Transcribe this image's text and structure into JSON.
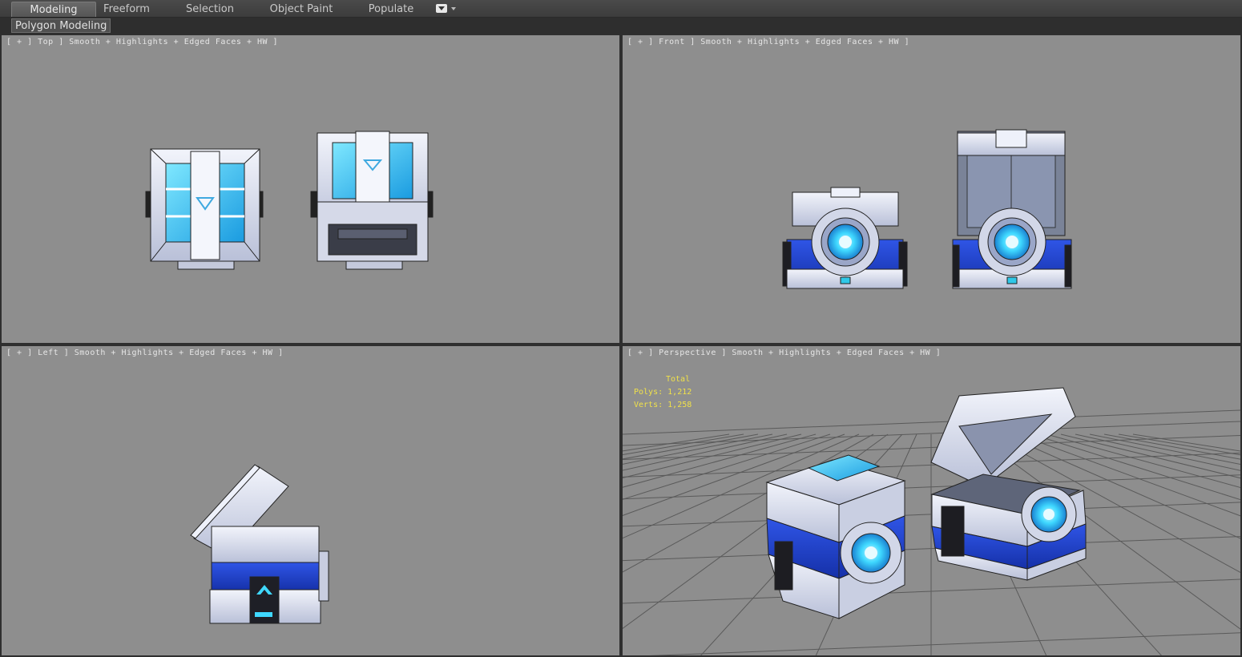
{
  "ribbon": {
    "tabs": [
      {
        "label": "Modeling",
        "active": true
      },
      {
        "label": "Freeform"
      },
      {
        "label": "Selection"
      },
      {
        "label": "Object Paint"
      },
      {
        "label": "Populate"
      }
    ],
    "dropdown_icon": "ribbon-options-icon"
  },
  "subpanel": {
    "label": "Polygon Modeling"
  },
  "viewports": {
    "top": {
      "label": "[ + ] Top ] Smooth + Highlights + Edged Faces + HW ]"
    },
    "front": {
      "label": "[ + ] Front ] Smooth + Highlights + Edged Faces + HW ]"
    },
    "left": {
      "label": "[ + ] Left ] Smooth + Highlights + Edged Faces + HW ]"
    },
    "perspective": {
      "label": "[ + ] Perspective ] Smooth + Highlights + Edged Faces + HW ]"
    }
  },
  "stats": {
    "total_label": "Total",
    "polys_label": "Polys:",
    "polys_value": "1,212",
    "verts_label": "Verts:",
    "verts_value": "1,258"
  },
  "colors": {
    "viewport_bg": "#8e8e8e",
    "stats_text": "#f0e14a",
    "chest_white": "#dfe3f0",
    "chest_blue": "#1f3fd0",
    "glow_cyan": "#3fd8ff"
  }
}
